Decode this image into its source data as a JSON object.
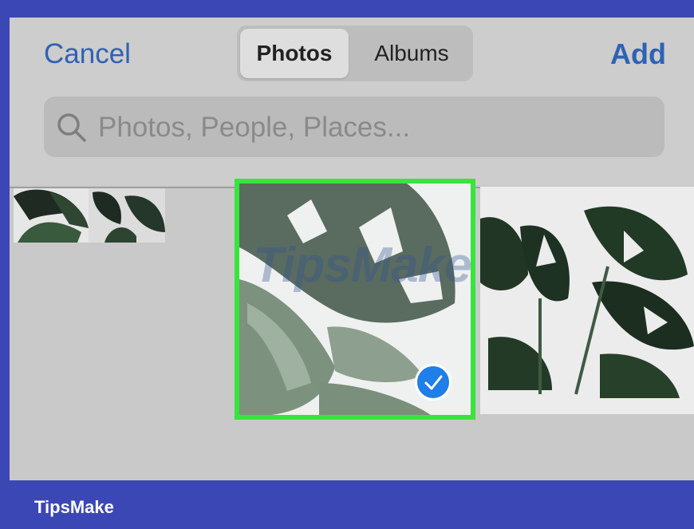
{
  "nav": {
    "cancel_label": "Cancel",
    "add_label": "Add",
    "segments": [
      "Photos",
      "Albums"
    ],
    "selected_segment": "Photos"
  },
  "search": {
    "placeholder": "Photos, People, Places..."
  },
  "photos": {
    "selected_item": "selected",
    "icons": {
      "check": "checkmark-icon",
      "search": "search-icon"
    }
  },
  "watermark": {
    "text": "TipsMake"
  },
  "footer": {
    "brand": "TipsMake"
  },
  "colors": {
    "accent": "#2f62b3",
    "frame": "#3c47b6",
    "selection": "#37e53c",
    "check": "#1f7ee8"
  }
}
